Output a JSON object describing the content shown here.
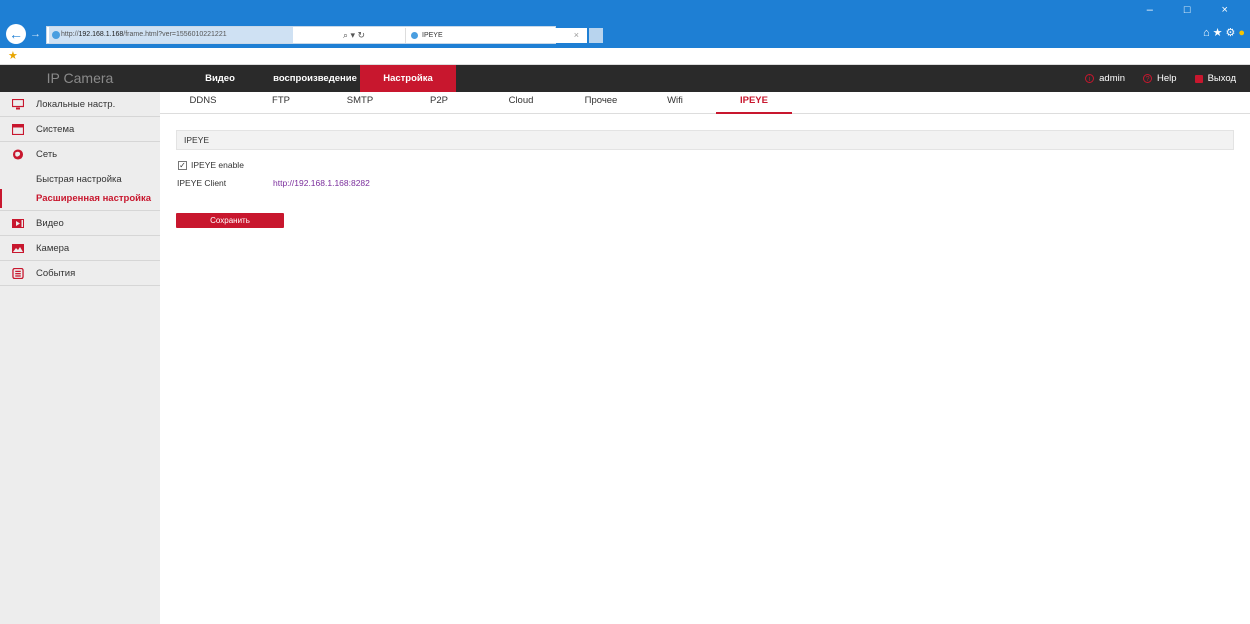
{
  "browser": {
    "url_prefix": "http://",
    "url_host": "192.168.1.168",
    "url_path": "/frame.html?ver=1556010221221",
    "address_tools": "⌕ ▾ ↻",
    "tab_title": "IPEYE",
    "tab_close": "×",
    "window_controls": "– □ ×",
    "toolbar_icons": "⌂★⚙"
  },
  "app": {
    "logo": "IP Camera",
    "main_nav": [
      {
        "label": "Видео",
        "width": 100,
        "active": false
      },
      {
        "label": "воспроизведение",
        "width": 90,
        "active": false
      },
      {
        "label": "Настройка",
        "width": 96,
        "active": true
      }
    ],
    "user": {
      "name": "admin",
      "help": "Help",
      "logout": "Выход"
    }
  },
  "sidebar": {
    "items": [
      {
        "label": "Локальные настр.",
        "icon": "monitor-icon"
      },
      {
        "label": "Система",
        "icon": "system-icon"
      },
      {
        "label": "Сеть",
        "icon": "network-icon"
      }
    ],
    "network_sub": [
      {
        "label": "Быстрая настройка",
        "active": false
      },
      {
        "label": "Расширенная настройка",
        "active": true
      }
    ],
    "items_after": [
      {
        "label": "Видео",
        "icon": "video-icon"
      },
      {
        "label": "Камера",
        "icon": "camera-icon"
      },
      {
        "label": "События",
        "icon": "events-icon"
      }
    ]
  },
  "subtabs": [
    {
      "label": "DDNS",
      "active": false
    },
    {
      "label": "FTP",
      "active": false
    },
    {
      "label": "SMTP",
      "active": false
    },
    {
      "label": "P2P",
      "active": false
    },
    {
      "label": "Cloud",
      "active": false
    },
    {
      "label": "Прочее",
      "active": false
    },
    {
      "label": "Wifi",
      "active": false
    },
    {
      "label": "IPEYE",
      "active": true
    }
  ],
  "content": {
    "panel_title": "IPEYE",
    "enable_label": "IPEYE enable",
    "enable_checked": true,
    "client_label": "IPEYE Client",
    "client_link": "http://192.168.1.168:8282",
    "save_label": "Сохранить"
  },
  "colors": {
    "accent": "#c8172e",
    "header_bg": "#2a2a2a",
    "browser_blue": "#1e7fd4",
    "link": "#7a2d9c"
  }
}
